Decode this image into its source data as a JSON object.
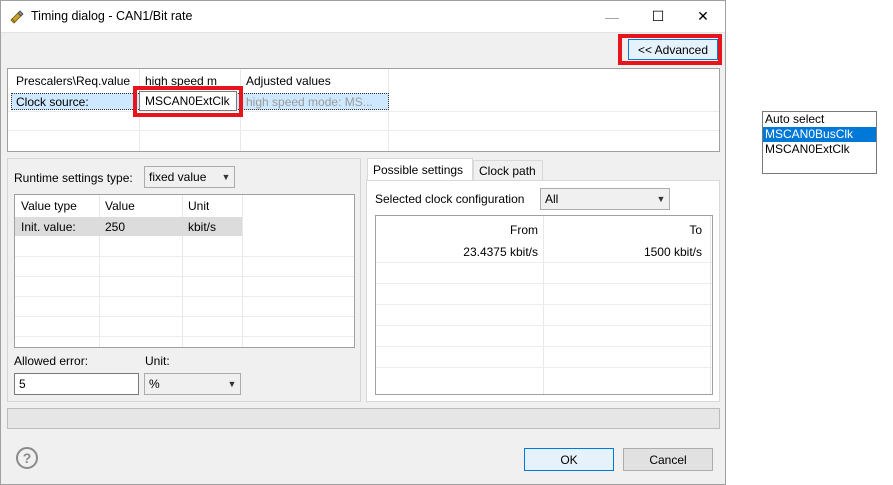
{
  "window": {
    "title": "Timing dialog - CAN1/Bit rate",
    "minimize_label": "—",
    "maximize_label": "☐",
    "close_label": "✕"
  },
  "toolbar": {
    "advanced_label": "<< Advanced"
  },
  "top_table": {
    "headers": [
      "Prescalers\\Req.value",
      "high speed m",
      "Adjusted values"
    ],
    "row": {
      "label": "Clock source:",
      "value": "MSCAN0ExtClk",
      "adjusted": "high speed mode: MS..."
    }
  },
  "runtime": {
    "label": "Runtime settings type:",
    "selected": "fixed value",
    "table_headers": [
      "Value type",
      "Value",
      "Unit"
    ],
    "rows": [
      {
        "type": "Init. value:",
        "value": "250",
        "unit": "kbit/s"
      }
    ],
    "allowed_error_label": "Allowed error:",
    "allowed_error_value": "5",
    "unit_label": "Unit:",
    "unit_value": "%"
  },
  "right_panel": {
    "tabs": [
      "Possible settings",
      "Clock path"
    ],
    "clock_config_label": "Selected clock configuration",
    "clock_config_value": "All",
    "headers": [
      "From",
      "To"
    ],
    "rows": [
      {
        "from": "23.4375 kbit/s",
        "to": "1500 kbit/s"
      }
    ]
  },
  "footer": {
    "ok_label": "OK",
    "cancel_label": "Cancel",
    "help_label": "?"
  },
  "dropdown": {
    "options": [
      "Auto select",
      "MSCAN0BusClk",
      "MSCAN0ExtClk"
    ],
    "selected_index": 1
  },
  "colors": {
    "highlight": "#e8141c",
    "selection": "#0078d7",
    "accent_border": "#0078d7"
  }
}
